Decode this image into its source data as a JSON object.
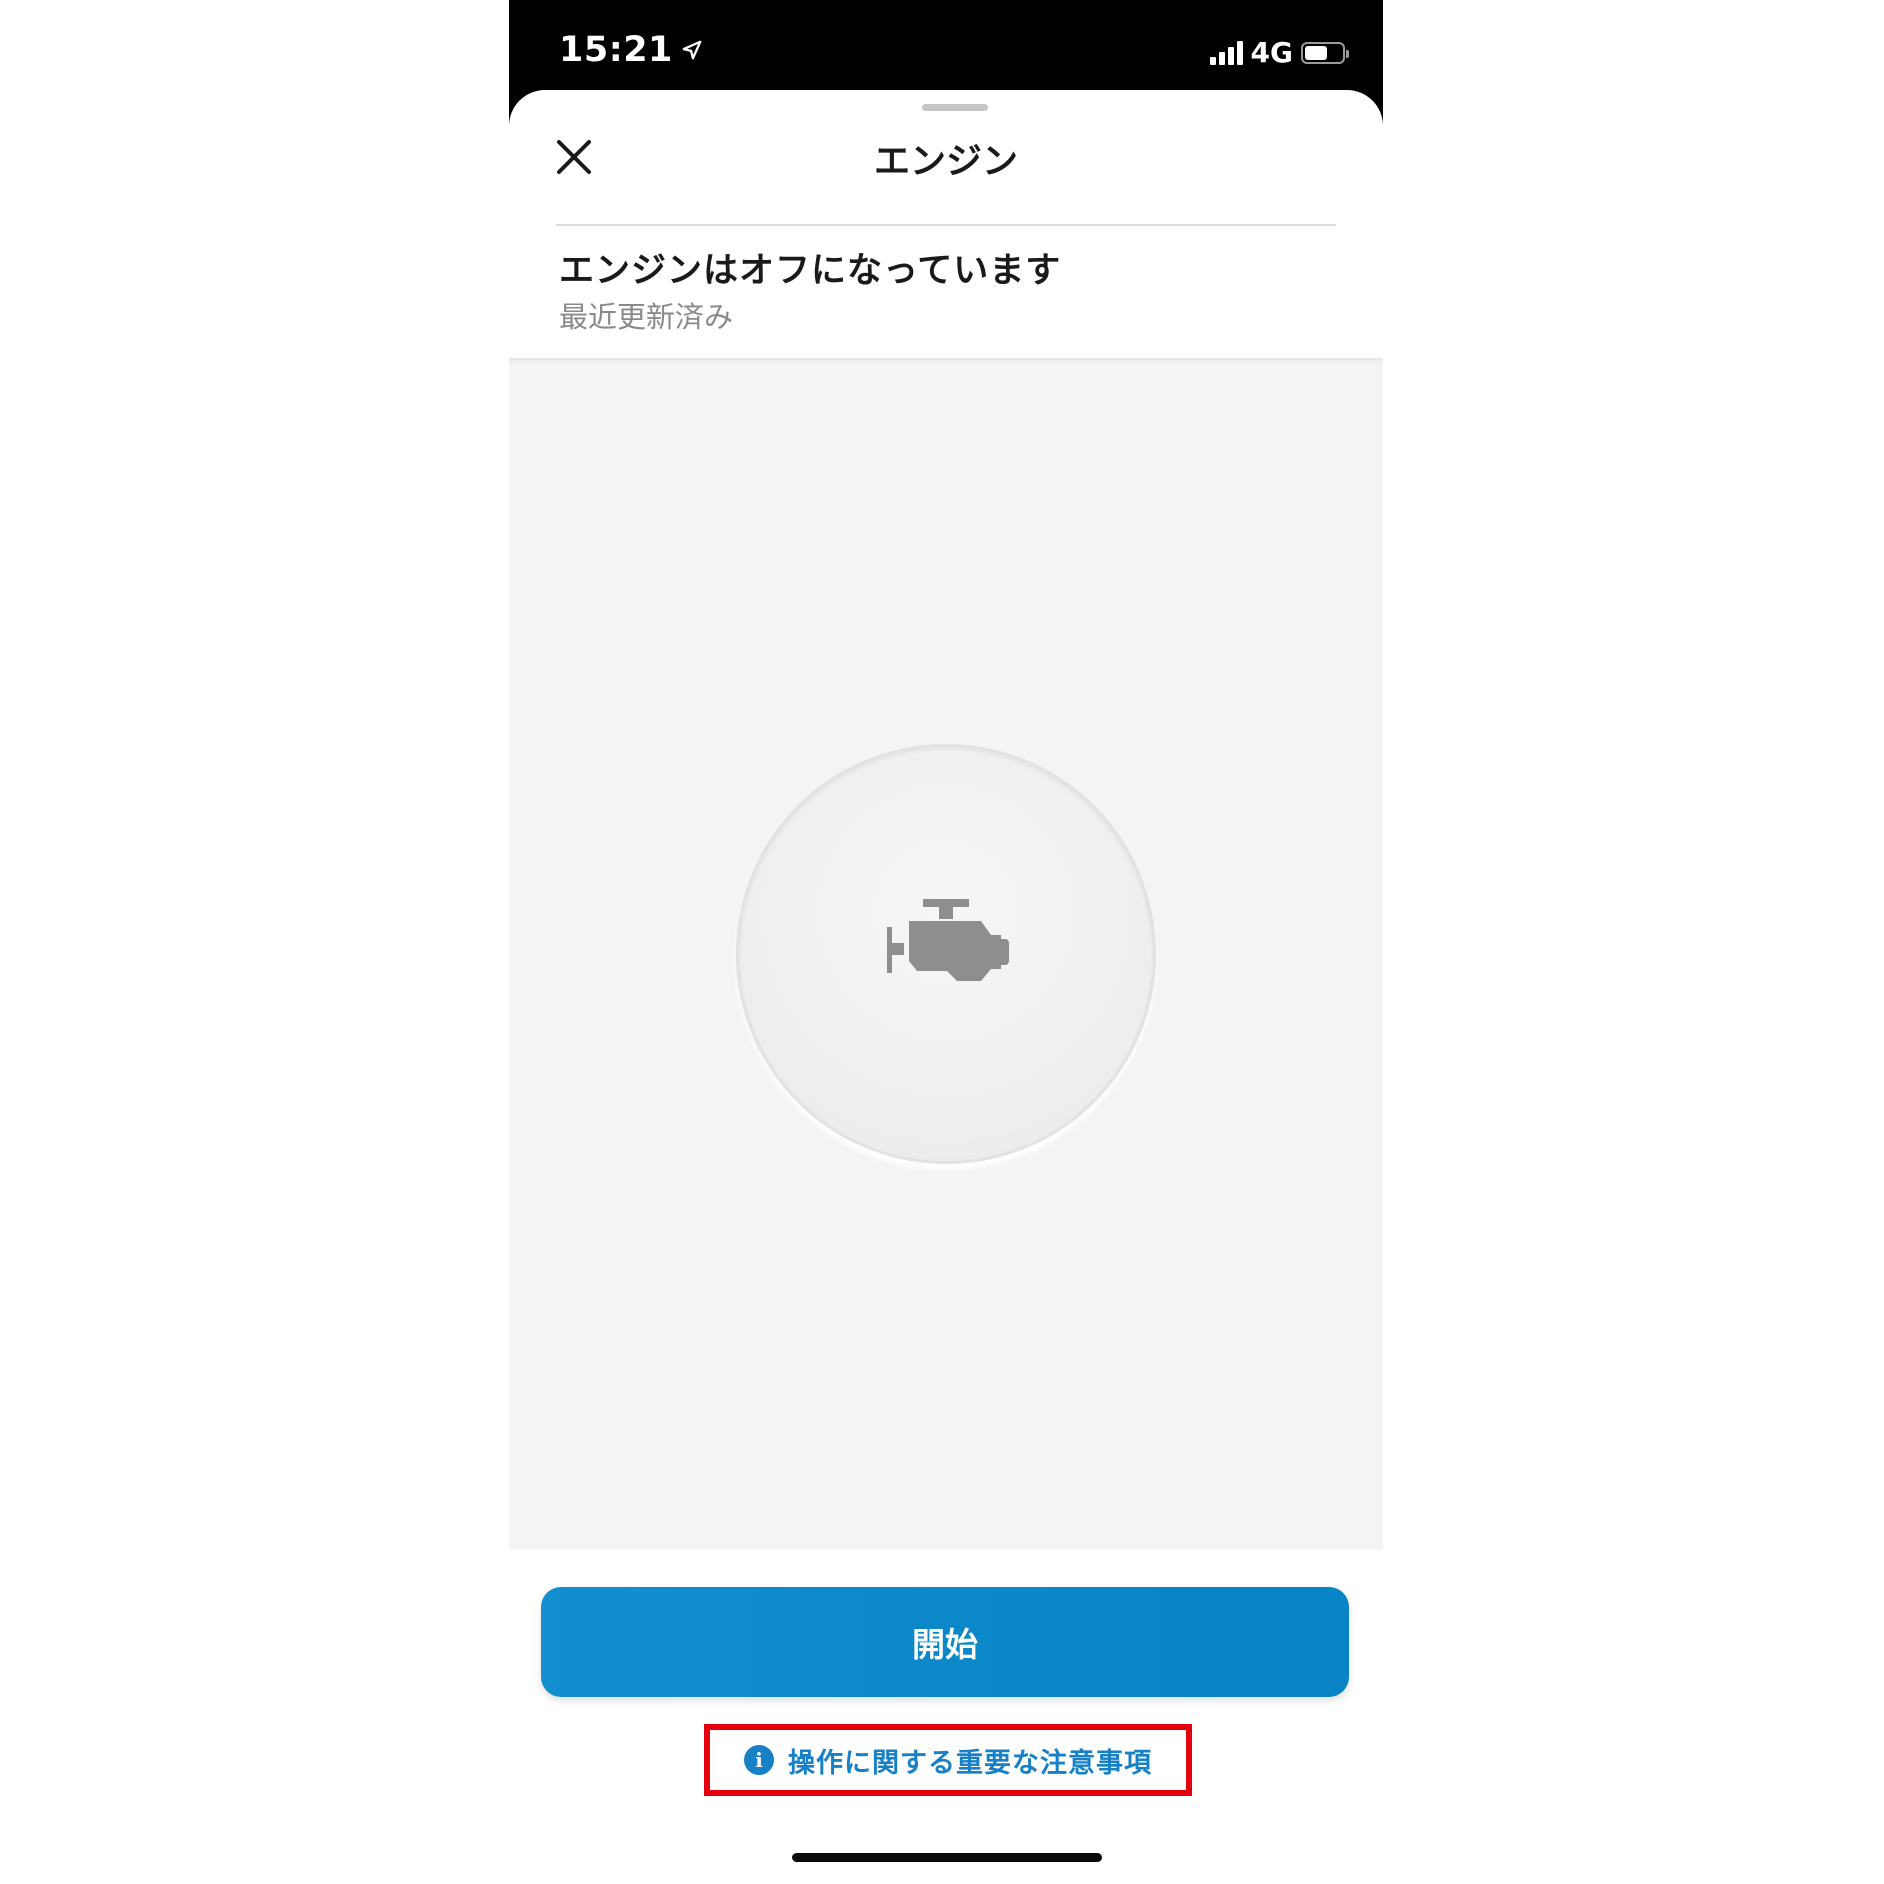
{
  "status_bar": {
    "time": "15:21",
    "network": "4G",
    "battery_level": 0.6
  },
  "sheet": {
    "title": "エンジン",
    "status_title": "エンジンはオフになっています",
    "status_subtitle": "最近更新済み"
  },
  "icons": {
    "close": "close-icon",
    "engine": "engine-icon",
    "info": "info-icon",
    "location": "location-arrow-icon"
  },
  "actions": {
    "start_label": "開始",
    "notice_label": "操作に関する重要な注意事項",
    "info_glyph": "i"
  },
  "colors": {
    "accent": "#0b88c8",
    "notice_text": "#1780c6",
    "highlight_border": "#e3000f",
    "panel_bg": "#f4f4f4"
  }
}
